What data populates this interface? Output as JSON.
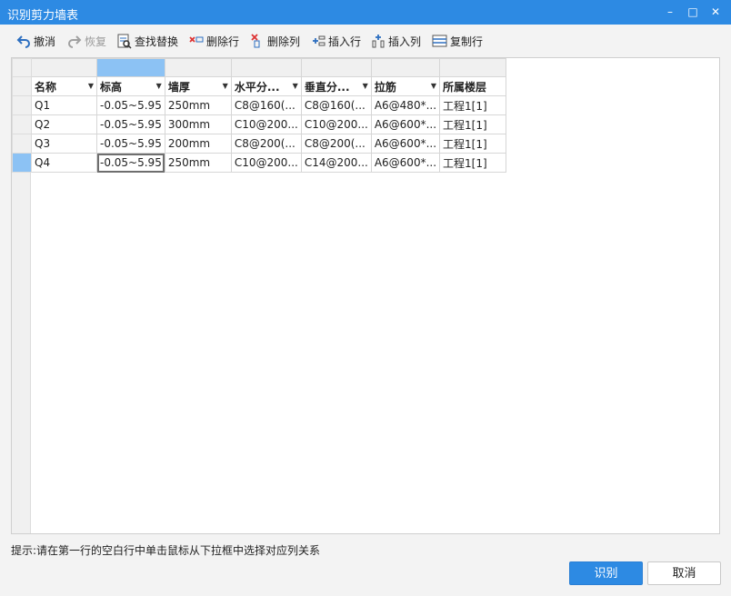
{
  "window": {
    "title": "识别剪力墙表",
    "minimize_label": "–",
    "maximize_label": "□",
    "close_label": "✕"
  },
  "toolbar": {
    "undo": "撤消",
    "redo": "恢复",
    "find_replace": "查找替换",
    "delete_row": "删除行",
    "delete_col": "删除列",
    "insert_row": "插入行",
    "insert_col": "插入列",
    "copy_row": "复制行"
  },
  "table": {
    "headers": [
      "名称",
      "标高",
      "墙厚",
      "水平分...",
      "垂直分...",
      "拉筋",
      "所属楼层"
    ],
    "rows": [
      [
        "Q1",
        "-0.05~5.95",
        "250mm",
        "C8@160(...",
        "C8@160(...",
        "A6@480*...",
        "工程1[1]"
      ],
      [
        "Q2",
        "-0.05~5.95",
        "300mm",
        "C10@200...",
        "C10@200...",
        "A6@600*...",
        "工程1[1]"
      ],
      [
        "Q3",
        "-0.05~5.95",
        "200mm",
        "C8@200(...",
        "C8@200(...",
        "A6@600*...",
        "工程1[1]"
      ],
      [
        "Q4",
        "-0.05~5.95",
        "250mm",
        "C10@200...",
        "C14@200...",
        "A6@600*...",
        "工程1[1]"
      ]
    ]
  },
  "hint": "提示:请在第一行的空白行中单击鼠标从下拉框中选择对应列关系",
  "buttons": {
    "recognize": "识别",
    "cancel": "取消"
  },
  "colors": {
    "accent": "#2d8ae3",
    "selection": "#8cc2f4"
  }
}
